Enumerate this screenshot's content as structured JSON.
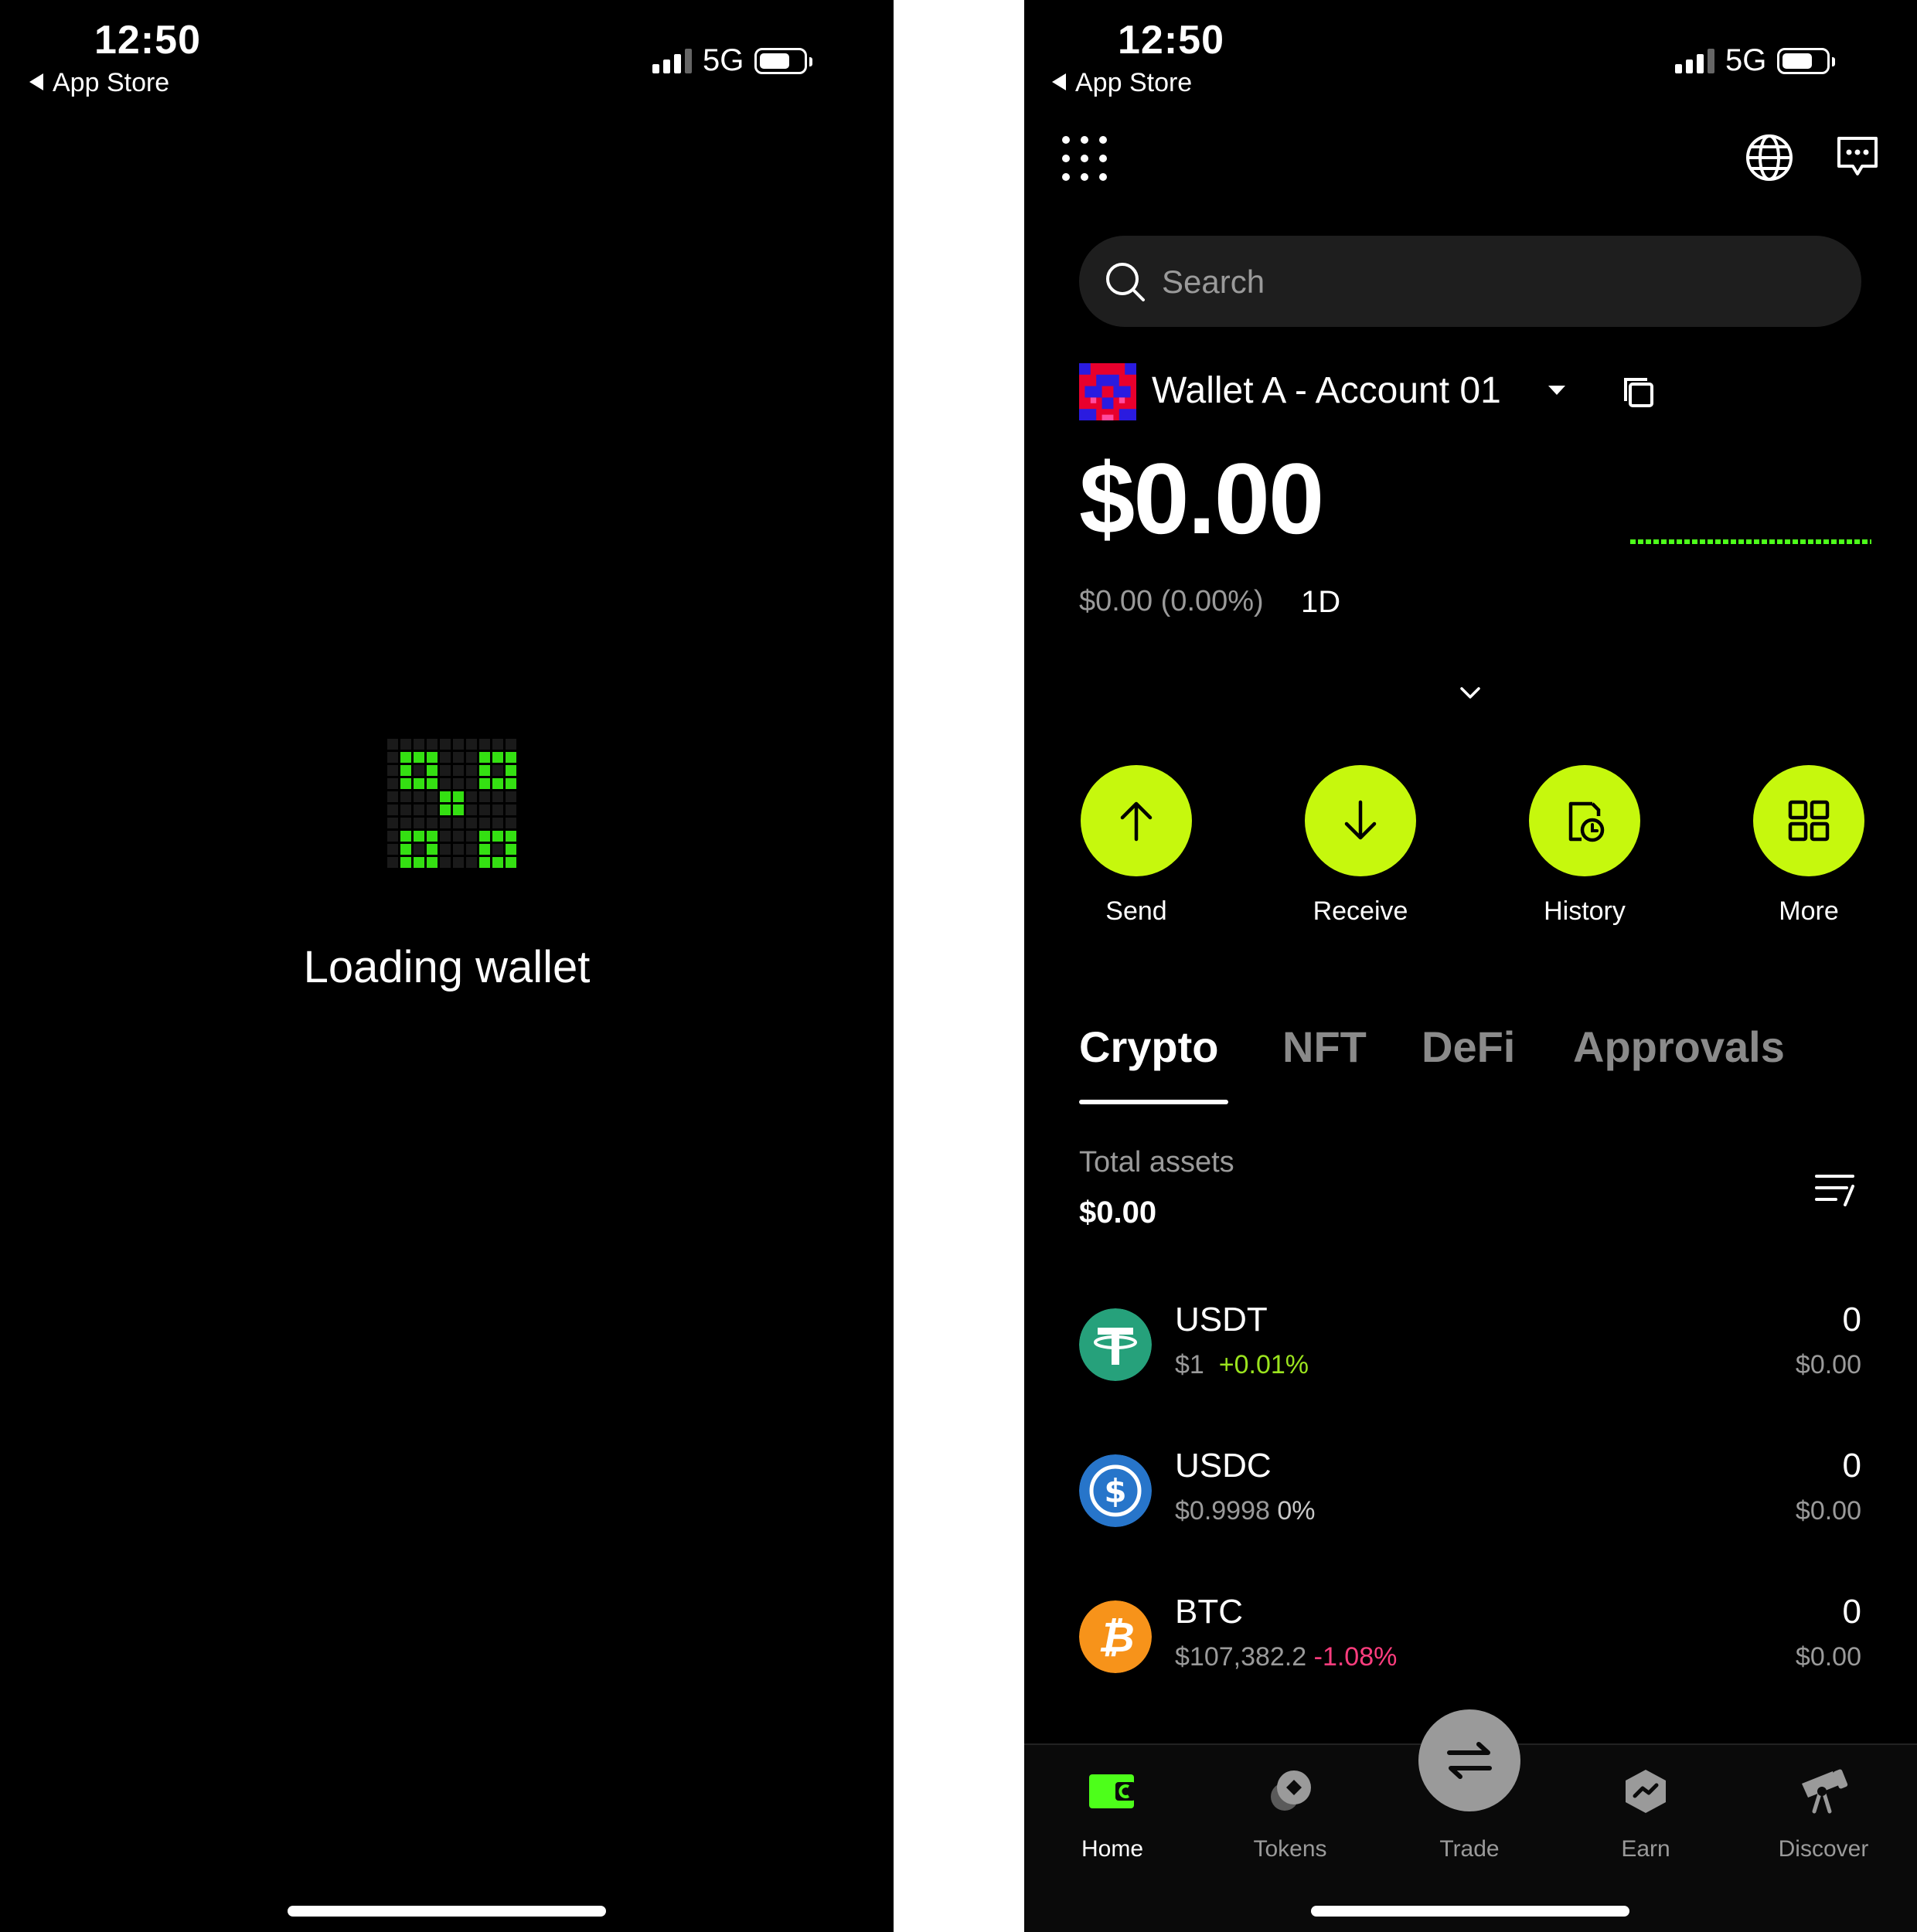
{
  "status_bar": {
    "time": "12:50",
    "back_label": "App Store",
    "network": "5G"
  },
  "loading": {
    "text": "Loading wallet",
    "accent": "#34e012"
  },
  "header": {
    "icons": [
      "grid-dots-icon",
      "globe-icon",
      "chat-icon"
    ]
  },
  "search": {
    "placeholder": "Search"
  },
  "wallet": {
    "name": "Wallet A - Account 01",
    "balance": "$0.00",
    "change": "$0.00 (0.00%)",
    "period": "1D"
  },
  "actions": [
    {
      "label": "Send",
      "icon": "arrow-up-icon"
    },
    {
      "label": "Receive",
      "icon": "arrow-down-icon"
    },
    {
      "label": "History",
      "icon": "history-icon"
    },
    {
      "label": "More",
      "icon": "grid-icon"
    }
  ],
  "tabs": [
    {
      "label": "Crypto",
      "active": true
    },
    {
      "label": "NFT",
      "active": false
    },
    {
      "label": "DeFi",
      "active": false
    },
    {
      "label": "Approvals",
      "active": false
    }
  ],
  "total_assets": {
    "label": "Total assets",
    "value": "$0.00"
  },
  "assets": [
    {
      "symbol": "USDT",
      "price": "$1",
      "change": "+0.01%",
      "amount": "0",
      "value": "$0.00",
      "color": "#26a17b"
    },
    {
      "symbol": "USDC",
      "price": "$0.9998",
      "change": "0%",
      "amount": "0",
      "value": "$0.00",
      "color": "#2775ca"
    },
    {
      "symbol": "BTC",
      "price": "$107,382.2",
      "change": "-1.08%",
      "amount": "0",
      "value": "$0.00",
      "color": "#f7931a"
    }
  ],
  "nav": [
    {
      "label": "Home",
      "active": true
    },
    {
      "label": "Tokens",
      "active": false
    },
    {
      "label": "Trade",
      "active": false
    },
    {
      "label": "Earn",
      "active": false
    },
    {
      "label": "Discover",
      "active": false
    }
  ],
  "colors": {
    "accent": "#c6f80d",
    "positive": "#9be41e",
    "negative": "#ff3d7e",
    "muted": "#9a9a9a"
  }
}
